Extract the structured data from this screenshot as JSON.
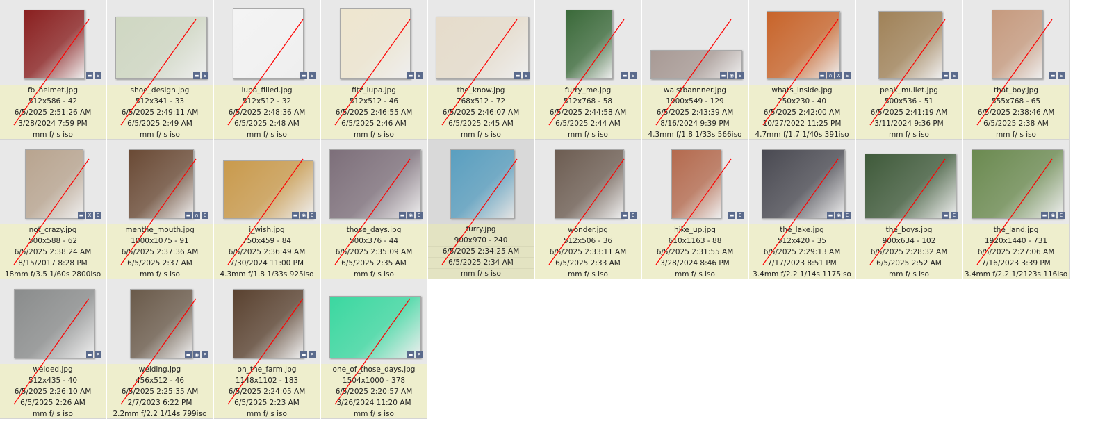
{
  "badge_icons": {
    "minus": "minimize-badge-icon",
    "E": "exif-badge-icon",
    "O": "location-badge-icon",
    "X": "xmp-badge-icon",
    "lock": "lock-badge-icon"
  },
  "colors": {
    "info_bg": "#eeeecd",
    "thumb_bg": "#e8e8e8",
    "slash": "#ff0000",
    "badge": "#5a6a8c"
  },
  "files": [
    {
      "name": "fb_helmet.jpg",
      "dims": "512x586 - 42",
      "modified": "6/5/2025 2:51:26 AM",
      "taken": "3/28/2024 7:59 PM",
      "exif": "mm f/ s iso",
      "badges": [
        "minus",
        "E"
      ],
      "thumb": "#8a2020"
    },
    {
      "name": "shoe_design.jpg",
      "dims": "512x341 - 33",
      "modified": "6/5/2025 2:49:11 AM",
      "taken": "6/5/2025 2:49 AM",
      "exif": "mm f/ s iso",
      "badges": [
        "minus",
        "E"
      ],
      "thumb": "#cfd7c2"
    },
    {
      "name": "lupa_filled.jpg",
      "dims": "512x512 - 32",
      "modified": "6/5/2025 2:48:36 AM",
      "taken": "6/5/2025 2:48 AM",
      "exif": "mm f/ s iso",
      "badges": [
        "minus",
        "E"
      ],
      "thumb": "#f4f4f4"
    },
    {
      "name": "fitz_lupa.jpg",
      "dims": "512x512 - 46",
      "modified": "6/5/2025 2:46:55 AM",
      "taken": "6/5/2025 2:46 AM",
      "exif": "mm f/ s iso",
      "badges": [
        "minus",
        "E"
      ],
      "thumb": "#eee6cf"
    },
    {
      "name": "the_know.jpg",
      "dims": "768x512 - 72",
      "modified": "6/5/2025 2:46:07 AM",
      "taken": "6/5/2025 2:45 AM",
      "exif": "mm f/ s iso",
      "badges": [
        "minus",
        "E"
      ],
      "thumb": "#e6dccb"
    },
    {
      "name": "furry_me.jpg",
      "dims": "512x768 - 58",
      "modified": "6/5/2025 2:44:58 AM",
      "taken": "6/5/2025 2:44 AM",
      "exif": "mm f/ s iso",
      "badges": [
        "minus",
        "E"
      ],
      "thumb": "#3b6a3a"
    },
    {
      "name": "waistbannner.jpg",
      "dims": "1900x549 - 129",
      "modified": "6/5/2025 2:43:39 AM",
      "taken": "8/16/2024 9:39 PM",
      "exif": "4.3mm f/1.8 1/33s 566iso",
      "badges": [
        "minus",
        "O",
        "E"
      ],
      "thumb": "#a89a95"
    },
    {
      "name": "whats_inside.jpg",
      "dims": "250x230 - 40",
      "modified": "6/5/2025 2:42:00 AM",
      "taken": "10/27/2022 11:25 PM",
      "exif": "4.7mm f/1.7 1/40s 391iso",
      "badges": [
        "minus",
        "lock",
        "X",
        "E"
      ],
      "thumb": "#c8642a"
    },
    {
      "name": "peak_mullet.jpg",
      "dims": "500x536 - 51",
      "modified": "6/5/2025 2:41:19 AM",
      "taken": "3/11/2024 9:36 PM",
      "exif": "mm f/ s iso",
      "badges": [
        "minus",
        "E"
      ],
      "thumb": "#a08258"
    },
    {
      "name": "that_boy.jpg",
      "dims": "555x768 - 65",
      "modified": "6/5/2025 2:38:46 AM",
      "taken": "6/5/2025 2:38 AM",
      "exif": "mm f/ s iso",
      "badges": [
        "minus",
        "E"
      ],
      "thumb": "#c69a7e"
    },
    {
      "name": "not_crazy.jpg",
      "dims": "500x588 - 62",
      "modified": "6/5/2025 2:38:24 AM",
      "taken": "8/15/2017 8:28 PM",
      "exif": "18mm f/3.5 1/60s 2800iso",
      "badges": [
        "minus",
        "X",
        "E"
      ],
      "thumb": "#b8a48f"
    },
    {
      "name": "menthe_mouth.jpg",
      "dims": "1000x1075 - 91",
      "modified": "6/5/2025 2:37:36 AM",
      "taken": "6/5/2025 2:37 AM",
      "exif": "mm f/ s iso",
      "badges": [
        "minus",
        "lock",
        "E"
      ],
      "thumb": "#6a4a35"
    },
    {
      "name": "i_wish.jpg",
      "dims": "750x459 - 84",
      "modified": "6/5/2025 2:36:49 AM",
      "taken": "7/30/2024 11:00 PM",
      "exif": "4.3mm f/1.8 1/33s 925iso",
      "badges": [
        "minus",
        "O",
        "E"
      ],
      "thumb": "#c99a4c"
    },
    {
      "name": "those_days.jpg",
      "dims": "500x376 - 44",
      "modified": "6/5/2025 2:35:09 AM",
      "taken": "6/5/2025 2:35 AM",
      "exif": "mm f/ s iso",
      "badges": [
        "minus",
        "O",
        "E"
      ],
      "thumb": "#7d6f7a"
    },
    {
      "name": "furry.jpg",
      "dims": "900x970 - 240",
      "modified": "6/5/2025 2:34:25 AM",
      "taken": "6/5/2025 2:34 AM",
      "exif": "mm f/ s iso",
      "badges": [],
      "thumb": "#5a9fc0",
      "selected": true
    },
    {
      "name": "wonder.jpg",
      "dims": "512x506 - 36",
      "modified": "6/5/2025 2:33:11 AM",
      "taken": "6/5/2025 2:33 AM",
      "exif": "mm f/ s iso",
      "badges": [
        "minus",
        "E"
      ],
      "thumb": "#6d5d52"
    },
    {
      "name": "hike_up.jpg",
      "dims": "610x1163 - 88",
      "modified": "6/5/2025 2:31:55 AM",
      "taken": "3/28/2024 8:46 PM",
      "exif": "mm f/ s iso",
      "badges": [
        "minus",
        "E"
      ],
      "thumb": "#b46a4e"
    },
    {
      "name": "the_lake.jpg",
      "dims": "512x420 - 35",
      "modified": "6/5/2025 2:29:13 AM",
      "taken": "7/17/2023 8:51 PM",
      "exif": "3.4mm f/2.2 1/14s 1175iso",
      "badges": [
        "minus",
        "O",
        "E"
      ],
      "thumb": "#4a4a52"
    },
    {
      "name": "the_boys.jpg",
      "dims": "900x634 - 102",
      "modified": "6/5/2025 2:28:32 AM",
      "taken": "6/5/2025 2:52 AM",
      "exif": "mm f/ s iso",
      "badges": [
        "minus",
        "E"
      ],
      "thumb": "#3f5a3a"
    },
    {
      "name": "the_land.jpg",
      "dims": "1920x1440 - 731",
      "modified": "6/5/2025 2:27:06 AM",
      "taken": "7/16/2023 3:39 PM",
      "exif": "3.4mm f/2.2 1/2123s 116iso",
      "badges": [
        "minus",
        "O",
        "E"
      ],
      "thumb": "#6b8a50"
    },
    {
      "name": "welded.jpg",
      "dims": "512x435 - 40",
      "modified": "6/5/2025 2:26:10 AM",
      "taken": "6/5/2025 2:26 AM",
      "exif": "mm f/ s iso",
      "badges": [
        "minus",
        "E"
      ],
      "thumb": "#8a8c8c"
    },
    {
      "name": "welding.jpg",
      "dims": "456x512 - 46",
      "modified": "6/5/2025 2:25:35 AM",
      "taken": "2/7/2023 6:22 PM",
      "exif": "2.2mm f/2.2 1/14s 799iso",
      "badges": [
        "minus",
        "O",
        "E"
      ],
      "thumb": "#6a5a4a"
    },
    {
      "name": "on_the_farm.jpg",
      "dims": "1148x1102 - 183",
      "modified": "6/5/2025 2:24:05 AM",
      "taken": "6/5/2025 2:23 AM",
      "exif": "mm f/ s iso",
      "badges": [
        "minus",
        "E"
      ],
      "thumb": "#5a4230"
    },
    {
      "name": "one_of_those_days.jpg",
      "dims": "1504x1000 - 378",
      "modified": "6/5/2025 2:20:57 AM",
      "taken": "3/26/2024 11:20 AM",
      "exif": "mm f/ s iso",
      "badges": [
        "minus",
        "E"
      ],
      "thumb": "#3bd8a0"
    }
  ]
}
